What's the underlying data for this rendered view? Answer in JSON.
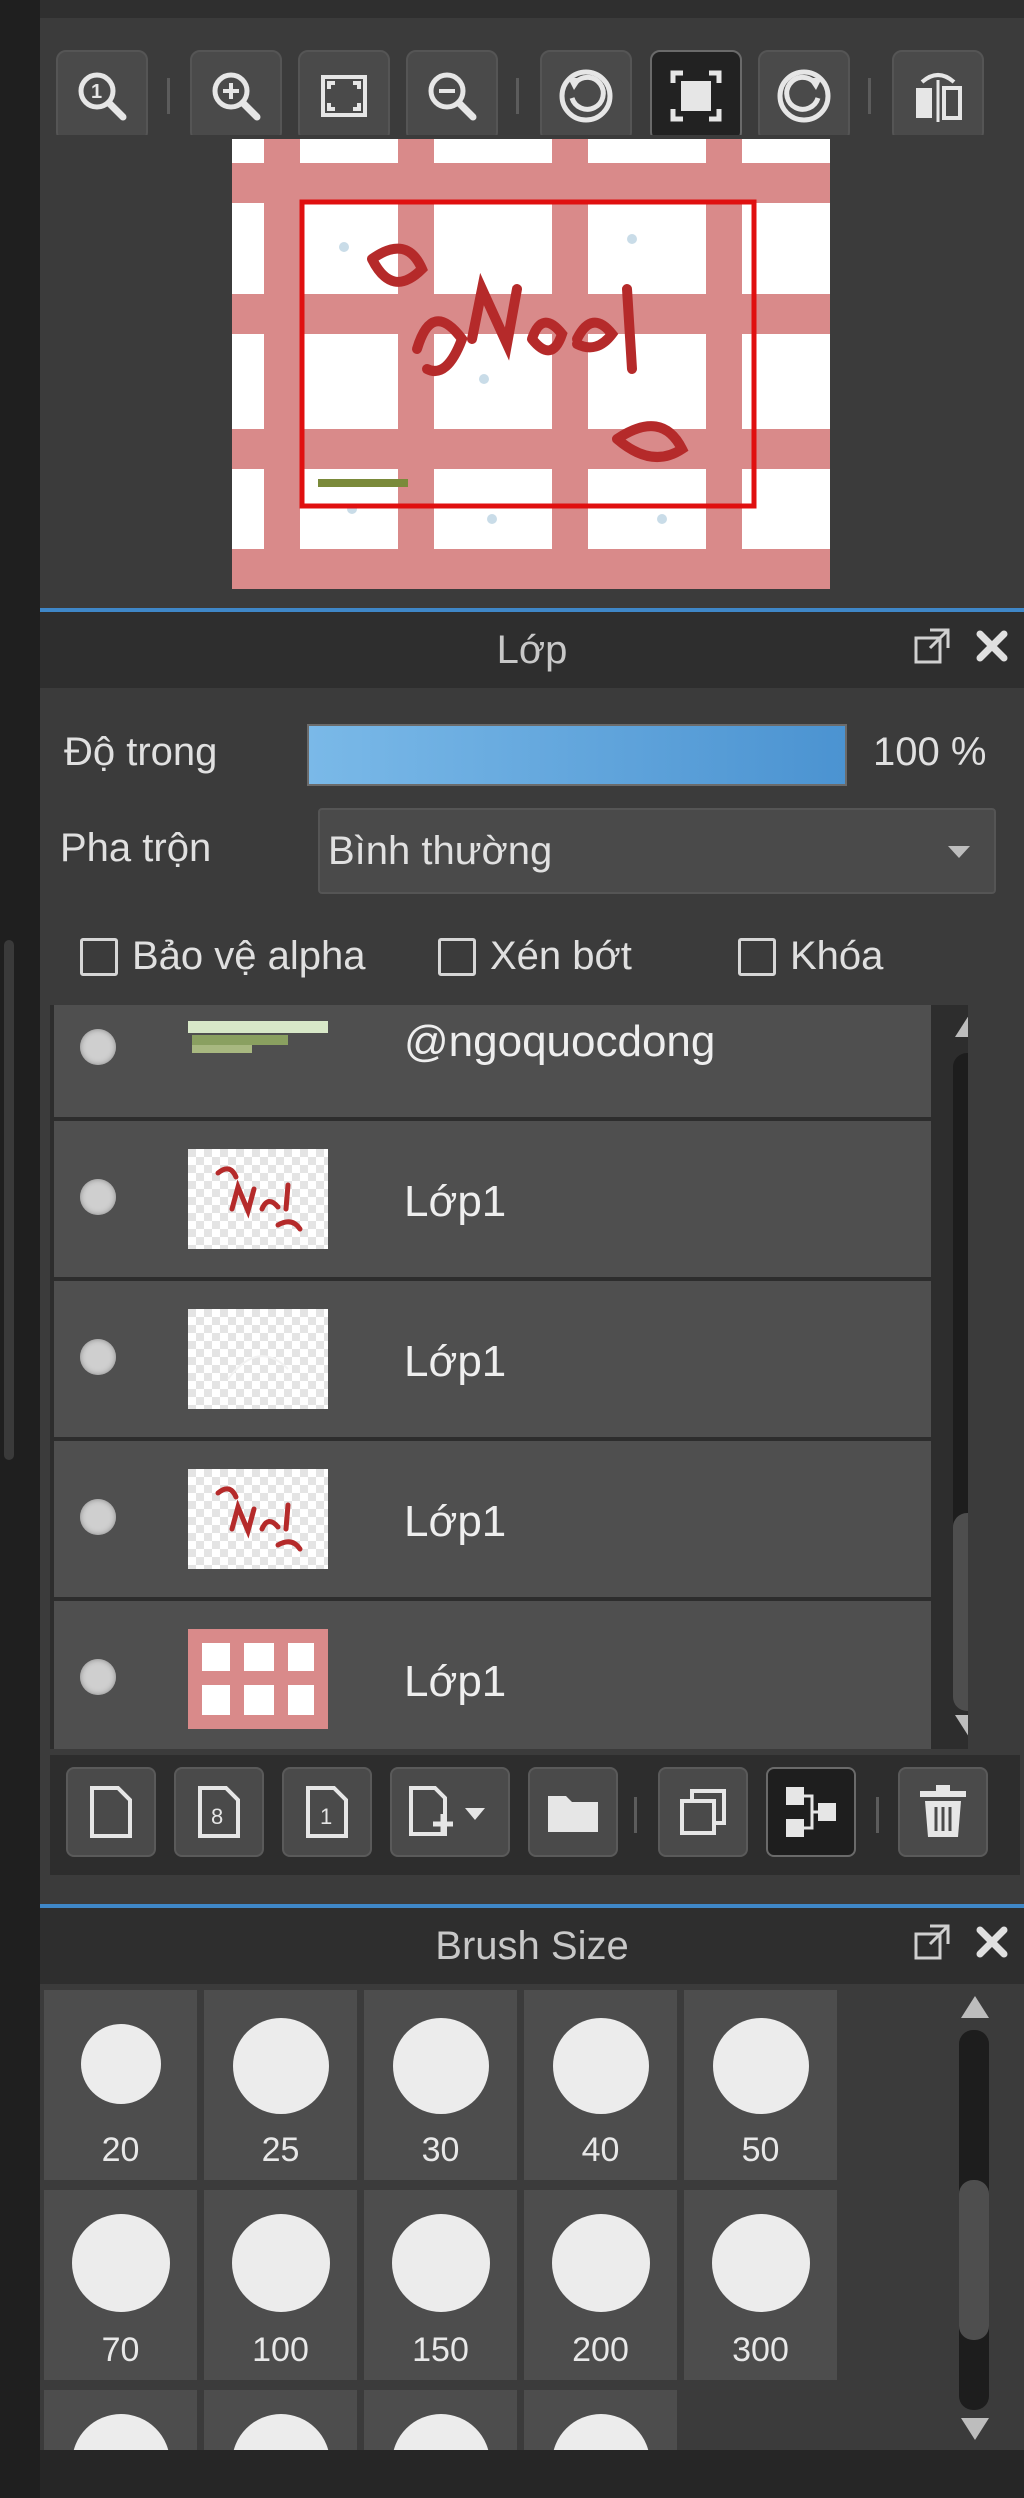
{
  "colors": {
    "panel_bg": "#3b3b3b",
    "header_accent": "#3f87c8",
    "opacity_fill": "#5ea6de",
    "preview_frame": "#e01010",
    "canvas_pink": "#d98a8a"
  },
  "navigator": {
    "tools": [
      {
        "icon": "zoom-actual-size-icon"
      },
      {
        "icon": "zoom-in-icon"
      },
      {
        "icon": "fit-to-window-icon"
      },
      {
        "icon": "zoom-out-icon"
      },
      {
        "icon": "rotate-left-icon"
      },
      {
        "icon": "reset-view-icon"
      },
      {
        "icon": "rotate-right-icon"
      },
      {
        "icon": "flip-horizontal-icon"
      }
    ]
  },
  "layer_panel": {
    "title": "Lớp",
    "opacity_label": "Độ trong",
    "opacity_value": "100 %",
    "opacity_fraction": 1.0,
    "blend_label": "Pha trộn",
    "blend_value": "Bình thường",
    "checkboxes": [
      {
        "label": "Bảo vệ alpha",
        "checked": false
      },
      {
        "label": "Xén bớt",
        "checked": false
      },
      {
        "label": "Khóa",
        "checked": false
      }
    ],
    "layers": [
      {
        "name": "@ngoquocdong",
        "thumb": "signature-text"
      },
      {
        "name": "Lớp1",
        "thumb": "noel-text"
      },
      {
        "name": "Lớp1",
        "thumb": "transparent-sketch"
      },
      {
        "name": "Lớp1",
        "thumb": "noel-text"
      },
      {
        "name": "Lớp1",
        "thumb": "pink-grid"
      }
    ],
    "actions": [
      {
        "icon": "new-layer-icon"
      },
      {
        "icon": "new-8bit-layer-icon"
      },
      {
        "icon": "new-1bit-layer-icon"
      },
      {
        "icon": "add-layer-dropdown-icon"
      },
      {
        "icon": "new-folder-icon"
      },
      {
        "icon": "duplicate-layer-icon"
      },
      {
        "icon": "merge-layer-icon"
      },
      {
        "icon": "delete-layer-icon"
      }
    ]
  },
  "brush_panel": {
    "title": "Brush Size",
    "sizes": [
      "20",
      "25",
      "30",
      "40",
      "50",
      "70",
      "100",
      "150",
      "200",
      "300"
    ]
  }
}
